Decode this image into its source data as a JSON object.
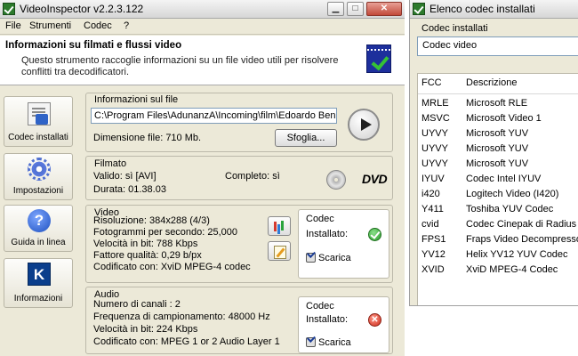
{
  "main_window": {
    "title": "VideoInspector v2.2.3.122",
    "menu": [
      "File",
      "Strumenti",
      "Codec",
      "?"
    ],
    "header": {
      "title": "Informazioni su filmati e flussi video",
      "description": "Questo strumento raccoglie informazioni su un file video utili per risolvere conflitti tra decodificatori."
    },
    "sidebar": [
      "Codec installati",
      "Impostazioni",
      "Guida in linea",
      "Informazioni"
    ],
    "file_info": {
      "title": "Informazioni sul file",
      "path": "C:\\Program Files\\AdunanzA\\Incoming\\film\\Edoardo Bennato - Cia",
      "size_label": "Dimensione file: 710 Mb.",
      "browse_label": "Sfoglia..."
    },
    "filmato": {
      "title": "Filmato",
      "valid": "Valido: sì [AVI]",
      "complete": "Completo: sì",
      "duration": "Durata: 01.38.03",
      "dvd_logo": "DVD"
    },
    "video": {
      "title": "Video",
      "lines": [
        "Risoluzione: 384x288 (4/3)",
        "Fotogrammi per secondo: 25,000",
        "Velocità in bit: 788 Kbps",
        "Fattore qualità: 0,29 b/px",
        "Codificato con: XviD MPEG-4 codec"
      ],
      "codec_title": "Codec",
      "installed_label": "Installato:",
      "download_label": "Scarica",
      "installed": true
    },
    "audio": {
      "title": "Audio",
      "lines": [
        "Numero di canali : 2",
        "Frequenza di campionamento: 48000 Hz",
        "Velocità in bit: 224 Kbps",
        "Codificato con: MPEG 1 or 2 Audio Layer 1"
      ],
      "codec_title": "Codec",
      "installed_label": "Installato:",
      "download_label": "Scarica",
      "installed": false
    }
  },
  "codec_window": {
    "title": "Elenco codec installati",
    "section_label": "Codec installati",
    "select_value": "Codec video",
    "columns": [
      "FCC",
      "Descrizione"
    ],
    "rows": [
      {
        "fcc": "MRLE",
        "desc": "Microsoft RLE"
      },
      {
        "fcc": "MSVC",
        "desc": "Microsoft Video 1"
      },
      {
        "fcc": "UYVY",
        "desc": "Microsoft YUV"
      },
      {
        "fcc": "UYVY",
        "desc": "Microsoft YUV"
      },
      {
        "fcc": "UYVY",
        "desc": "Microsoft YUV"
      },
      {
        "fcc": "IYUV",
        "desc": "Codec Intel IYUV"
      },
      {
        "fcc": "i420",
        "desc": "Logitech Video (I420)"
      },
      {
        "fcc": "Y411",
        "desc": "Toshiba YUV Codec"
      },
      {
        "fcc": "cvid",
        "desc": "Codec Cinepak di Radius"
      },
      {
        "fcc": "FPS1",
        "desc": "Fraps Video Decompressor"
      },
      {
        "fcc": "YV12",
        "desc": "Helix YV12 YUV Codec"
      },
      {
        "fcc": "XVID",
        "desc": "XviD MPEG-4 Codec"
      }
    ]
  },
  "icons": {
    "app": "check-app-icon",
    "play": "play-icon",
    "disc": "cd-icon",
    "ok": "green-check-icon",
    "no": "red-x-icon",
    "download": "download-icon"
  }
}
